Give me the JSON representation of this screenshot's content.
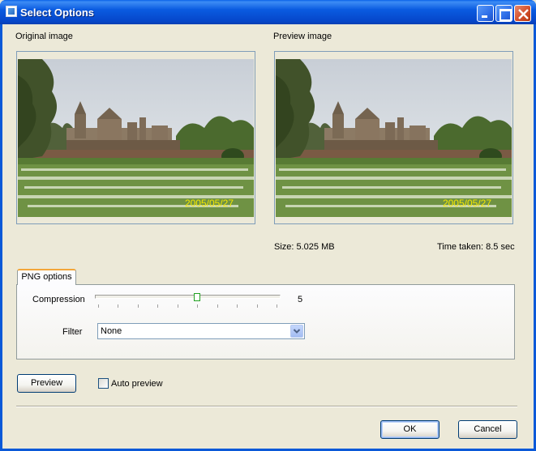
{
  "window": {
    "title": "Select Options"
  },
  "original": {
    "label": "Original image",
    "date_stamp": "2005/05/27"
  },
  "preview_image": {
    "label": "Preview image",
    "date_stamp": "2005/05/27",
    "size_text": "Size: 5.025 MB",
    "time_text": "Time taken: 8.5 sec"
  },
  "tabs": [
    {
      "label": "PNG options",
      "selected": true
    }
  ],
  "png_options": {
    "compression_label": "Compression",
    "compression_value": "5",
    "compression_min": 0,
    "compression_max": 9,
    "filter_label": "Filter",
    "filter_value": "None"
  },
  "actions": {
    "preview_label": "Preview",
    "auto_preview_label": "Auto preview",
    "auto_preview_checked": false,
    "ok_label": "OK",
    "cancel_label": "Cancel"
  },
  "icons": {
    "app": "app-icon",
    "minimize": "minimize-icon",
    "maximize": "maximize-icon",
    "close": "close-icon",
    "dropdown": "chevron-down-icon"
  }
}
